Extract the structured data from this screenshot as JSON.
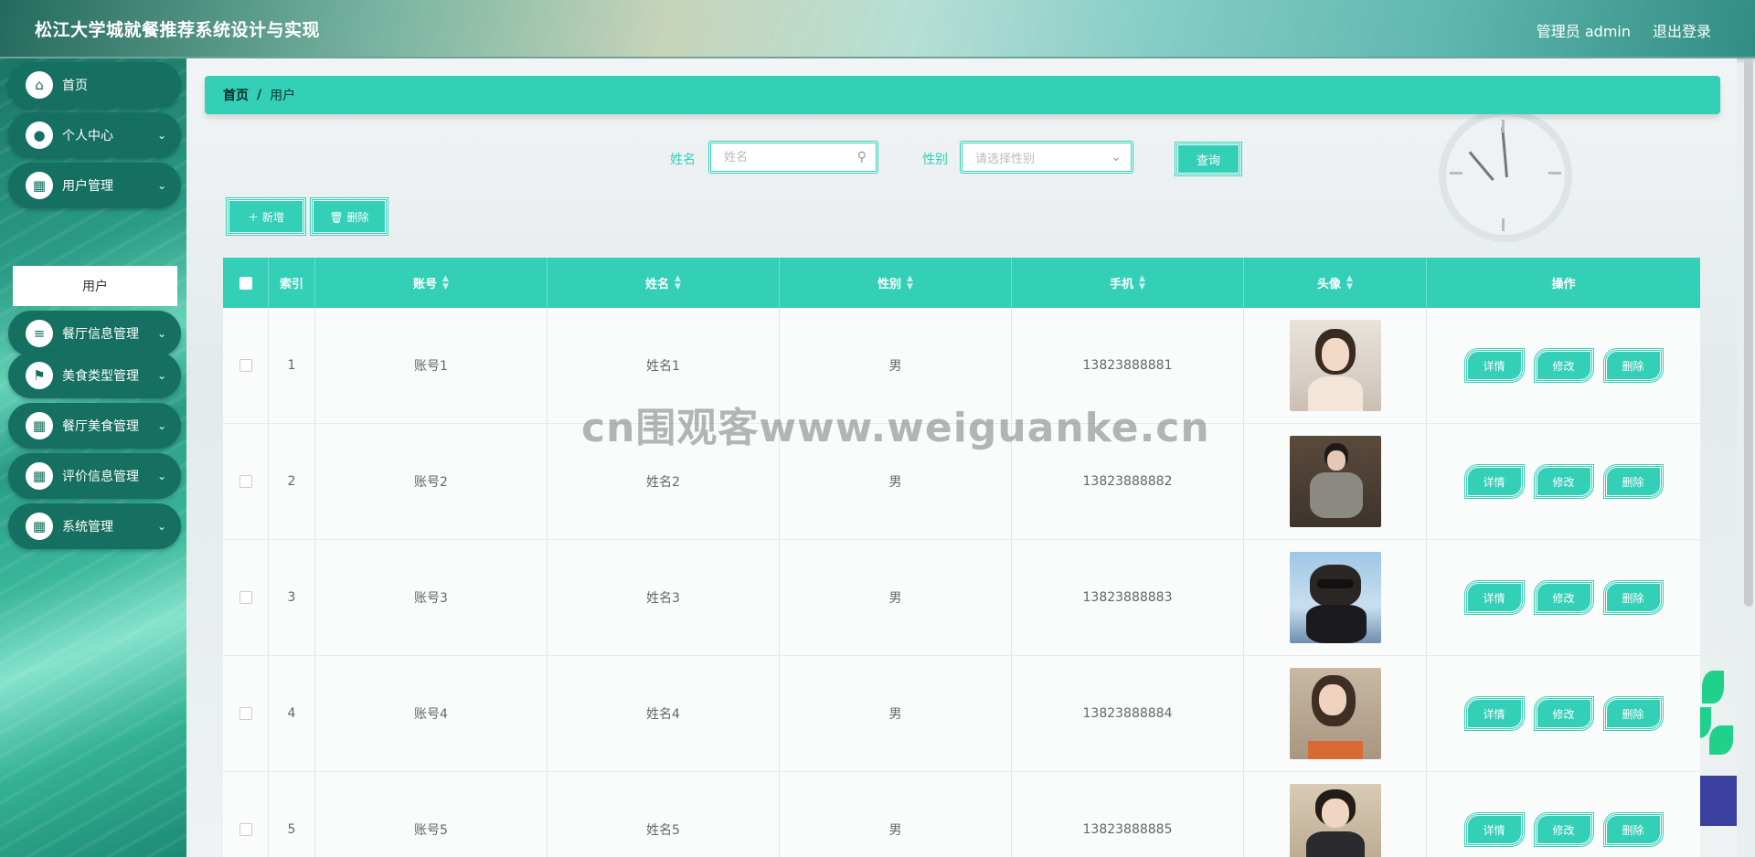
{
  "header": {
    "title": "松江大学城就餐推荐系统设计与实现",
    "user": "管理员 admin",
    "logout": "退出登录"
  },
  "sidebar": {
    "items": [
      {
        "label": "首页",
        "icon": "home-icon",
        "glyph": "⌂"
      },
      {
        "label": "个人中心",
        "icon": "person-icon",
        "glyph": "●",
        "chevron": "⌄"
      },
      {
        "label": "用户管理",
        "icon": "grid-icon",
        "glyph": "▦",
        "chevron": "⌄"
      },
      {
        "label": "餐厅信息管理",
        "icon": "list-icon",
        "glyph": "≡",
        "chevron": "⌄"
      },
      {
        "label": "美食类型管理",
        "icon": "flag-icon",
        "glyph": "⚑",
        "chevron": "⌄"
      },
      {
        "label": "餐厅美食管理",
        "icon": "grid-icon",
        "glyph": "▦",
        "chevron": "⌄"
      },
      {
        "label": "评价信息管理",
        "icon": "grid-icon",
        "glyph": "▦",
        "chevron": "⌄"
      },
      {
        "label": "系统管理",
        "icon": "grid-icon",
        "glyph": "▦",
        "chevron": "⌄"
      }
    ],
    "submenu": "用户"
  },
  "breadcrumb": {
    "home": "首页",
    "sep": "/",
    "current": "用户"
  },
  "search": {
    "name_label": "姓名",
    "name_placeholder": "姓名",
    "gender_label": "性别",
    "gender_placeholder": "请选择性别",
    "query_button": "查询"
  },
  "actions": {
    "add": "＋ 新增",
    "delete": "🗑 删除"
  },
  "table": {
    "headers": [
      "索引",
      "账号",
      "姓名",
      "性别",
      "手机",
      "头像",
      "操作"
    ],
    "rows": [
      {
        "index": "1",
        "account": "账号1",
        "name": "姓名1",
        "gender": "男",
        "phone": "13823888881"
      },
      {
        "index": "2",
        "account": "账号2",
        "name": "姓名2",
        "gender": "男",
        "phone": "13823888882"
      },
      {
        "index": "3",
        "account": "账号3",
        "name": "姓名3",
        "gender": "男",
        "phone": "13823888883"
      },
      {
        "index": "4",
        "account": "账号4",
        "name": "姓名4",
        "gender": "男",
        "phone": "13823888884"
      },
      {
        "index": "5",
        "account": "账号5",
        "name": "姓名5",
        "gender": "男",
        "phone": "13823888885"
      }
    ],
    "ops": {
      "detail": "详情",
      "edit": "修改",
      "delete": "删除"
    }
  },
  "watermark": "cn围观客www.weiguanke.cn",
  "colors": {
    "accent": "#33cfb7",
    "sidebar": "#157061"
  }
}
